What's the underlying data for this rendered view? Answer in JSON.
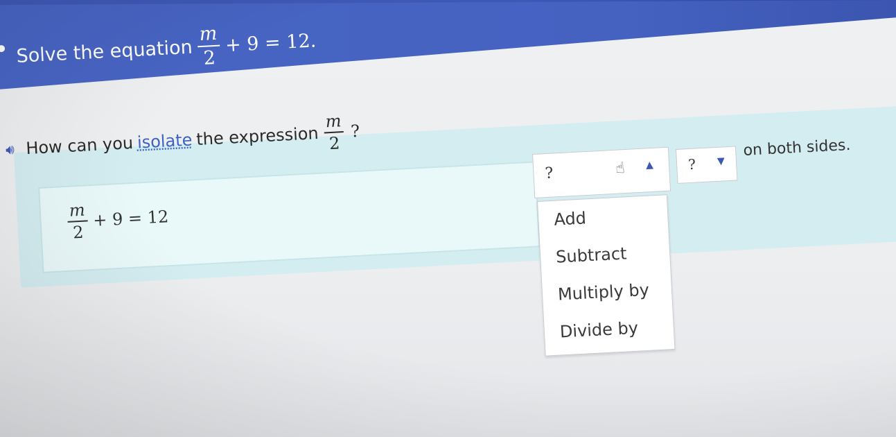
{
  "prompt": {
    "prefix": "Solve the equation",
    "frac_num": "m",
    "frac_den": "2",
    "rest": "+ 9 = 12."
  },
  "question": {
    "before": "How can you",
    "link": "isolate",
    "after": "the expression",
    "frac_num": "m",
    "frac_den": "2",
    "end": "?"
  },
  "work": {
    "frac_num": "m",
    "frac_den": "2",
    "rest": "+ 9 = 12"
  },
  "dropdown": {
    "selected": "?",
    "options": [
      "Add",
      "Subtract",
      "Multiply by",
      "Divide by"
    ]
  },
  "second_dropdown": {
    "selected": "?"
  },
  "tail": "on both sides.",
  "icons": {
    "speaker": "speaker-icon",
    "hand": "hand-pointer-icon",
    "caret_up": "caret-up-icon",
    "caret_down": "caret-down-icon"
  },
  "colors": {
    "header": "#4562c1",
    "panel": "#d4edf0",
    "link": "#3d62c4"
  }
}
